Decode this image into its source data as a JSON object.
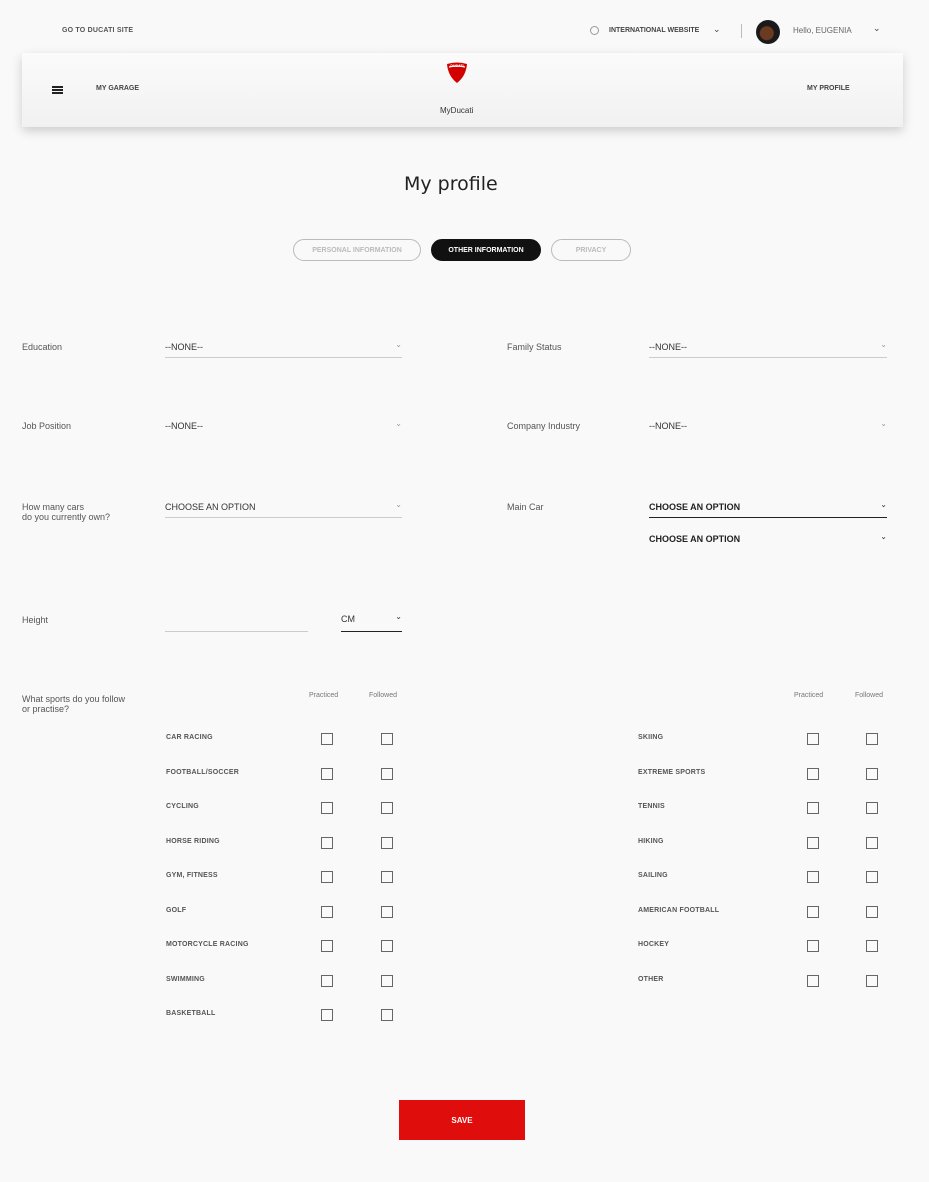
{
  "topbar": {
    "go_to_site": "GO TO DUCATI SITE",
    "website_label": "INTERNATIONAL WEBSITE",
    "hello": "Hello, EUGENIA"
  },
  "header": {
    "garage": "MY GARAGE",
    "brand": "MyDucati",
    "logo_text": "DUCATI",
    "profile": "MY PROFILE"
  },
  "page": {
    "title": "My profile"
  },
  "tabs": [
    {
      "label": "PERSONAL INFORMATION",
      "active": false
    },
    {
      "label": "OTHER INFORMATION",
      "active": true
    },
    {
      "label": "PRIVACY",
      "active": false
    }
  ],
  "fields": {
    "education": {
      "label": "Education",
      "value": "--NONE--"
    },
    "family_status": {
      "label": "Family Status",
      "value": "--NONE--"
    },
    "job_position": {
      "label": "Job Position",
      "value": "--NONE--"
    },
    "company_industry": {
      "label": "Company Industry",
      "value": "--NONE--"
    },
    "cars_owned": {
      "label_line1": "How many cars",
      "label_line2": "do you currently own?",
      "value": "CHOOSE AN OPTION"
    },
    "main_car": {
      "label": "Main Car",
      "value": "CHOOSE AN OPTION",
      "value2": "CHOOSE AN OPTION"
    },
    "height": {
      "label": "Height",
      "value": "",
      "unit": "CM"
    }
  },
  "sports": {
    "label_line1": "What sports do you follow",
    "label_line2": "or practise?",
    "practiced_label": "Practiced",
    "followed_label": "Followed",
    "left": [
      "CAR RACING",
      "FOOTBALL/SOCCER",
      "CYCLING",
      "HORSE RIDING",
      "GYM, FITNESS",
      "GOLF",
      "MOTORCYCLE RACING",
      "SWIMMING",
      "BASKETBALL"
    ],
    "right": [
      "SKIING",
      "EXTREME SPORTS",
      "TENNIS",
      "HIKING",
      "SAILING",
      "AMERICAN FOOTBALL",
      "HOCKEY",
      "OTHER"
    ]
  },
  "actions": {
    "save": "SAVE"
  },
  "colors": {
    "accent": "#e00d0d",
    "tab_active": "#111111"
  }
}
